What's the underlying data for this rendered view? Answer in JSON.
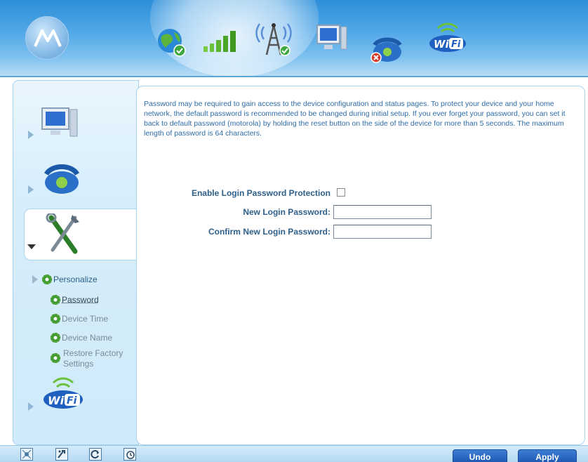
{
  "content": {
    "info": "Password may be required to gain access to the device configuration and status pages. To protect your device and your home network, the default password is recommended to be changed during initial setup. If you ever forget your password, you can set it back to default password (motorola) by holding the reset button on the side of the device for more than 5 seconds. The maximum length of password is 64 characters.",
    "enable_label": "Enable Login Password Protection",
    "enable_checked": false,
    "new_password_label": "New Login Password:",
    "new_password_value": "",
    "confirm_password_label": "Confirm New Login Password:",
    "confirm_password_value": ""
  },
  "sidebar": {
    "section": "Personalize",
    "items": [
      {
        "label": "Password",
        "selected": true
      },
      {
        "label": "Device Time",
        "selected": false
      },
      {
        "label": "Device Name",
        "selected": false
      },
      {
        "label": "Restore Factory Settings",
        "selected": false
      }
    ],
    "icons": [
      "computer-icon",
      "phone-icon",
      "tools-icon",
      "wifi-icon"
    ]
  },
  "header": {
    "icons": [
      "internet-status-icon",
      "signal-bars-icon",
      "tower-icon",
      "computer-icon",
      "phone-error-icon",
      "wifi-icon"
    ],
    "logo": "motorola-logo"
  },
  "footer": {
    "undo_label": "Undo",
    "apply_label": "Apply",
    "icons": [
      "sitemap-icon",
      "wizard-icon",
      "refresh-icon",
      "clock-icon"
    ]
  },
  "colors": {
    "header_blue": "#4fa6e6",
    "text_blue": "#2e6ca8",
    "button_blue": "#1c56b0",
    "sidebar_bg": "#d7eefb"
  }
}
